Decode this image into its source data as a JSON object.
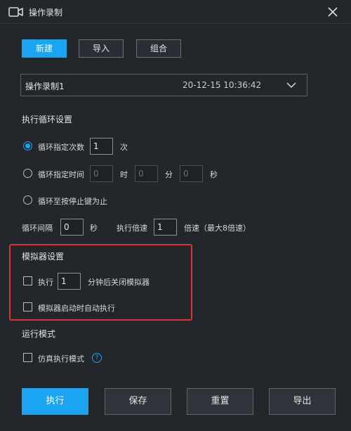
{
  "window": {
    "title": "操作录制"
  },
  "tabs": {
    "new": "新建",
    "import": "导入",
    "combine": "组合"
  },
  "recording": {
    "name": "操作录制1",
    "time": "20-12-15 10:36:42"
  },
  "loop": {
    "heading": "执行循环设置",
    "count_label": "循环指定次数",
    "count_value": "1",
    "count_unit": "次",
    "time_label": "循环指定时间",
    "hours_value": "0",
    "hours_unit": "时",
    "minutes_value": "0",
    "minutes_unit": "分",
    "seconds_value": "0",
    "seconds_unit": "秒",
    "until_stop_label": "循环至按停止键为止",
    "interval_label": "循环间隔",
    "interval_value": "0",
    "interval_unit": "秒",
    "speed_label": "执行倍速",
    "speed_value": "1",
    "speed_unit": "倍速（最大8倍速）"
  },
  "emulator": {
    "heading": "模拟器设置",
    "exec_label": "执行",
    "exec_minutes": "1",
    "exec_suffix": "分钟后关闭模拟器",
    "autostart_label": "模拟器启动时自动执行"
  },
  "run_mode": {
    "heading": "运行模式",
    "simulate_label": "仿真执行模式",
    "help_glyph": "?"
  },
  "actions": {
    "run": "执行",
    "save": "保存",
    "reset": "重置",
    "export": "导出"
  },
  "colors": {
    "accent": "#1aa4f2",
    "highlight": "#e0322f",
    "background": "#23262b"
  }
}
